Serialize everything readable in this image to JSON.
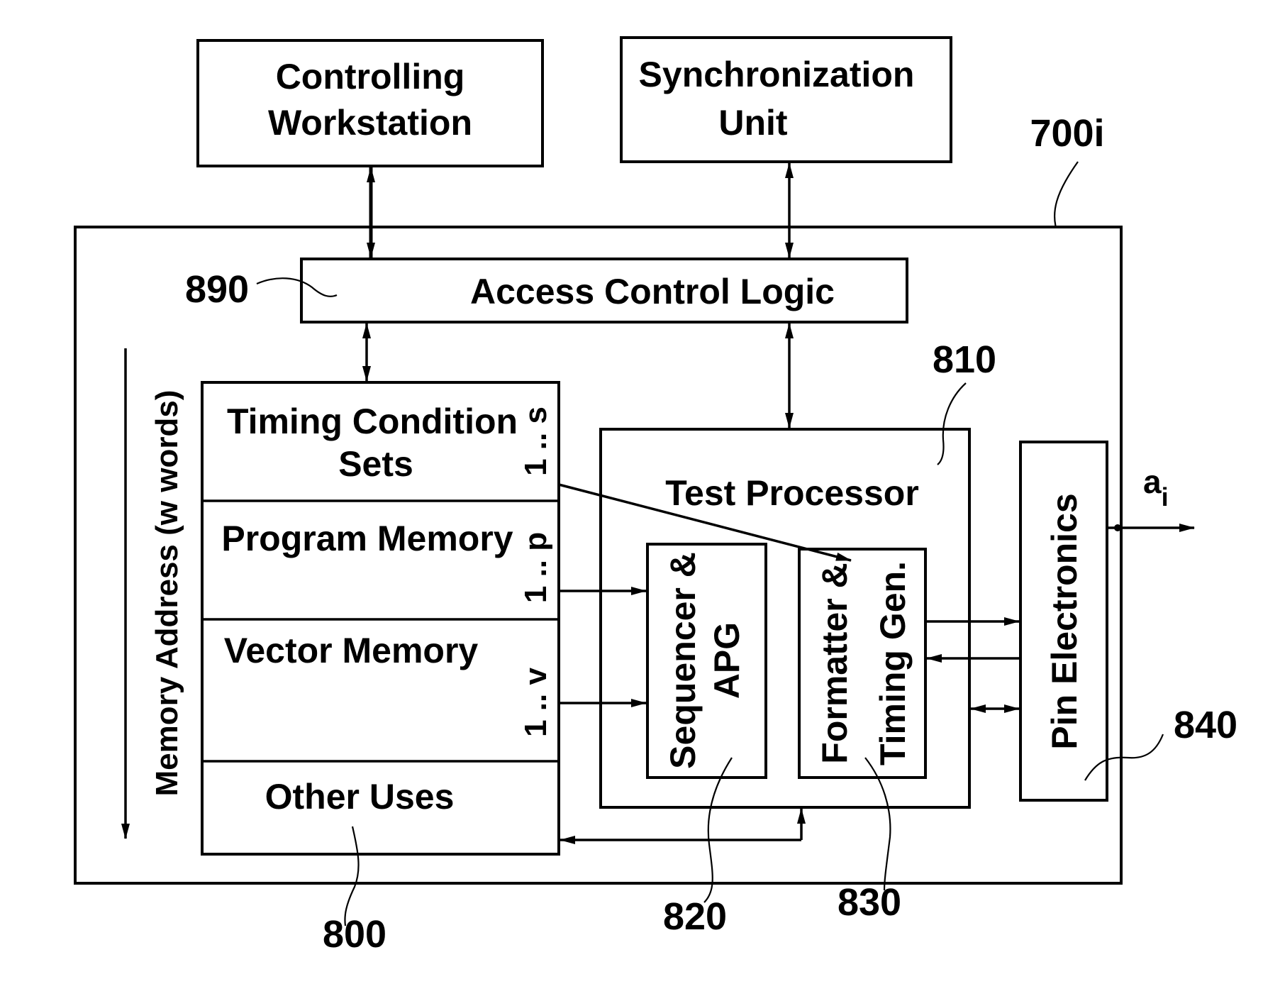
{
  "figure": {
    "reference": "700i",
    "external_blocks": {
      "controlling_workstation": [
        "Controlling",
        "Workstation"
      ],
      "synchronization_unit": [
        "Synchronization",
        "Unit"
      ]
    },
    "access_control_logic": {
      "label": "Access Control Logic",
      "ref": "890"
    },
    "memory": {
      "ref": "800",
      "axis_label": "Memory Address (w words)",
      "sections": [
        {
          "label_lines": [
            "Timing Condition",
            "Sets"
          ],
          "range": "1 .. s"
        },
        {
          "label_lines": [
            "Program Memory"
          ],
          "range": "1 .. p"
        },
        {
          "label_lines": [
            "Vector Memory"
          ],
          "range": "1 .. v"
        },
        {
          "label_lines": [
            "Other Uses"
          ],
          "range": ""
        }
      ]
    },
    "test_processor": {
      "label": "Test Processor",
      "ref": "810",
      "sequencer": {
        "lines": [
          "Sequencer &",
          "APG"
        ],
        "ref": "820"
      },
      "formatter": {
        "lines": [
          "Formatter &",
          "Timing Gen."
        ],
        "ref": "830"
      }
    },
    "pin_electronics": {
      "label": "Pin Electronics",
      "ref": "840"
    },
    "output_signal": {
      "base": "a",
      "subscript": "i"
    }
  }
}
